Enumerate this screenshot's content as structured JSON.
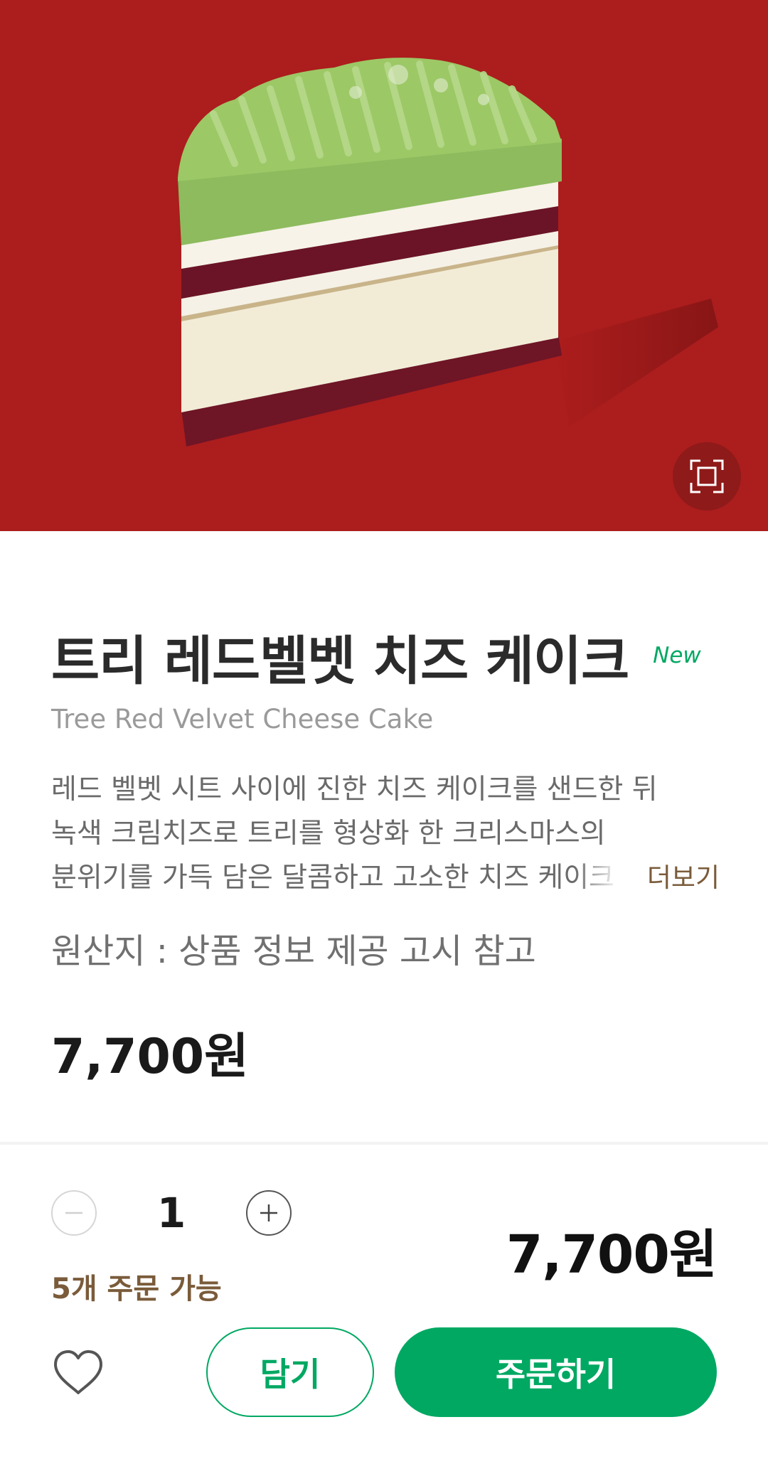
{
  "product": {
    "name_ko": "트리 레드벨벳 치즈 케이크",
    "badge": "New",
    "name_en": "Tree Red Velvet Cheese Cake",
    "description_lines": [
      "레드 벨벳 시트 사이에 진한 치즈 케이크를 샌드한 뒤",
      "녹색 크림치즈로 트리를 형상화 한 크리스마스의",
      "분위기를 가득 담은 달콤하고 고소한 치즈 케이크"
    ],
    "more_label": "더보기",
    "origin": "원산지 : 상품 정보 제공 고시 참고",
    "price": "7,700원"
  },
  "order": {
    "quantity": "1",
    "available": "5개 주문 가능",
    "total": "7,700원",
    "cart_label": "담기",
    "order_label": "주문하기"
  },
  "colors": {
    "hero_bg": "#ac1d1d",
    "brand_green": "#00a862",
    "accent_brown": "#7a5b3a"
  },
  "icons": {
    "zoom": "expand-frame-icon",
    "minus": "minus-circle-icon",
    "plus": "plus-circle-icon",
    "favorite": "heart-outline-icon"
  }
}
